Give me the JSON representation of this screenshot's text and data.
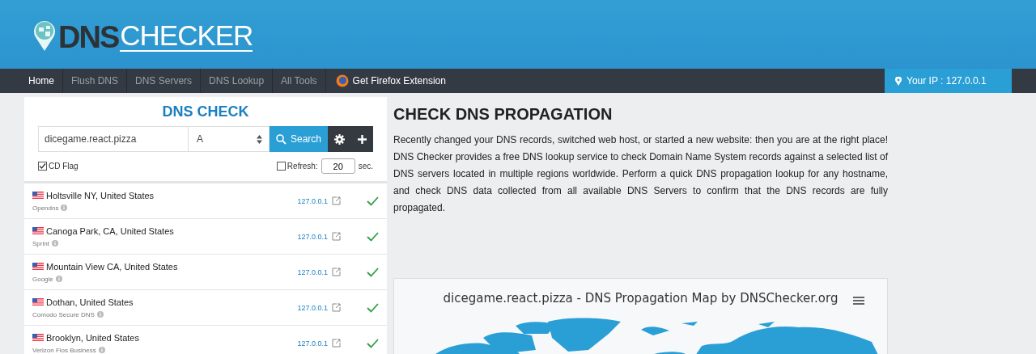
{
  "logo": {
    "part_1": "DNS",
    "part_2": "CHECKER"
  },
  "nav": [
    {
      "label": "Home",
      "selected": true
    },
    {
      "label": "Flush DNS",
      "selected": false
    },
    {
      "label": "DNS Servers",
      "selected": false
    },
    {
      "label": "DNS Lookup",
      "selected": false
    },
    {
      "label": "All Tools",
      "selected": false
    }
  ],
  "extension_link": "Get Firefox Extension",
  "your_ip": "Your IP : 127.0.0.1",
  "dns_check": {
    "title": "DNS CHECK",
    "hostname": "dicegame.react.pizza",
    "record_type": "A",
    "search_button": "Search",
    "cd_flag": {
      "label": "CD Flag",
      "checked": true
    },
    "refresh": {
      "label": "Refresh:",
      "checked": false,
      "value": "20",
      "unit": "sec."
    }
  },
  "results": [
    {
      "location": "Holtsville NY, United States",
      "provider": "Opendns",
      "ip": "127.0.0.1",
      "ok": true
    },
    {
      "location": "Canoga Park, CA, United States",
      "provider": "Sprint",
      "ip": "127.0.0.1",
      "ok": true
    },
    {
      "location": "Mountain View CA, United States",
      "provider": "Google",
      "ip": "127.0.0.1",
      "ok": true
    },
    {
      "location": "Dothan, United States",
      "provider": "Comodo Secure DNS",
      "ip": "127.0.0.1",
      "ok": true
    },
    {
      "location": "Brooklyn, United States",
      "provider": "Verizon Fios Business",
      "ip": "127.0.0.1",
      "ok": true
    }
  ],
  "heading": "CHECK DNS PROPAGATION",
  "intro": "Recently changed your DNS records, switched web host, or started a new website: then you are at the right place! DNS Checker provides a free DNS lookup service to check Domain Name System records against a selected list of DNS servers located in multiple regions worldwide. Perform a quick DNS propagation lookup for any hostname, and check DNS data collected from all available DNS Servers to confirm that the DNS records are fully propagated.",
  "map": {
    "title": "dicegame.react.pizza - DNS Propagation Map by DNSChecker.org"
  }
}
